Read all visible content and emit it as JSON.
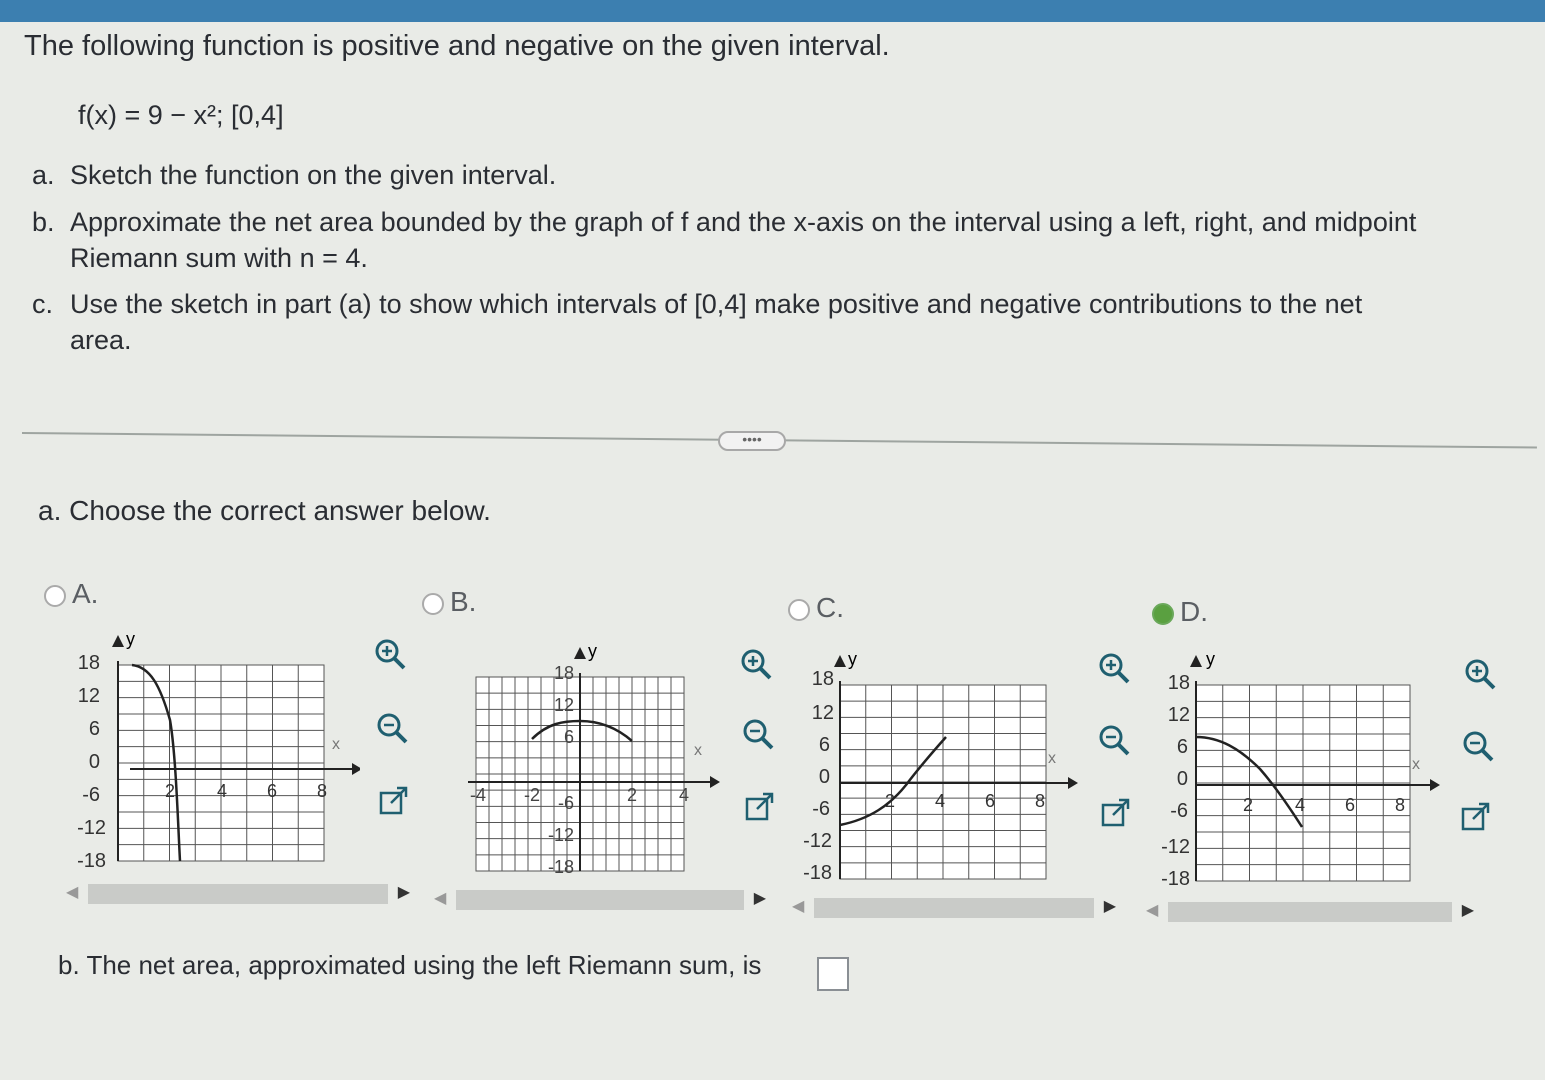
{
  "question": {
    "title": "The following function is positive and negative on the given interval.",
    "formula": "f(x) = 9 − x²; [0,4]",
    "parts": [
      {
        "label": "a.",
        "text": "Sketch the function on the given interval."
      },
      {
        "label": "b.",
        "text": "Approximate the net area bounded by the graph of f and the x-axis on the interval using a left, right, and midpoint",
        "text2": "Riemann sum with n = 4."
      },
      {
        "label": "c.",
        "text": "Use the sketch in part (a) to show which intervals of [0,4] make positive and negative contributions to the net",
        "text2": "area."
      }
    ]
  },
  "expand_label": "••••",
  "part_a": {
    "prompt": "a. Choose the correct answer below.",
    "options": [
      {
        "label": "A.",
        "selected": false
      },
      {
        "label": "B.",
        "selected": false
      },
      {
        "label": "C.",
        "selected": false
      },
      {
        "label": "D.",
        "selected": true
      }
    ]
  },
  "graphs": {
    "a": {
      "y_ticks": [
        "18",
        "12",
        "6",
        "0",
        "-6",
        "-12",
        "-18"
      ],
      "x_ticks": [
        "2",
        "4",
        "6",
        "8"
      ],
      "y_axis": "y",
      "x_axis": "x"
    },
    "b": {
      "y_ticks": [
        "18",
        "12",
        "6",
        "-6",
        "-12",
        "-18"
      ],
      "x_ticks": [
        "-4",
        "-2",
        "2",
        "4"
      ],
      "y_axis": "y",
      "x_axis": "x"
    },
    "c": {
      "y_ticks": [
        "18",
        "12",
        "6",
        "0",
        "-6",
        "-12",
        "-18"
      ],
      "x_ticks": [
        "2",
        "4",
        "6",
        "8"
      ],
      "y_axis": "y",
      "x_axis": "x"
    },
    "d": {
      "y_ticks": [
        "18",
        "12",
        "6",
        "0",
        "-6",
        "-12",
        "-18"
      ],
      "x_ticks": [
        "2",
        "4",
        "6",
        "8"
      ],
      "y_axis": "y",
      "x_axis": "x"
    }
  },
  "icons": [
    "zoom-in-icon",
    "zoom-out-icon",
    "popout-icon"
  ],
  "part_b": {
    "prompt": "b. The net area, approximated using the left Riemann sum, is",
    "answer": ""
  },
  "colors": {
    "topbar": "#3c7fb0",
    "selected_check": "#5aa040"
  }
}
